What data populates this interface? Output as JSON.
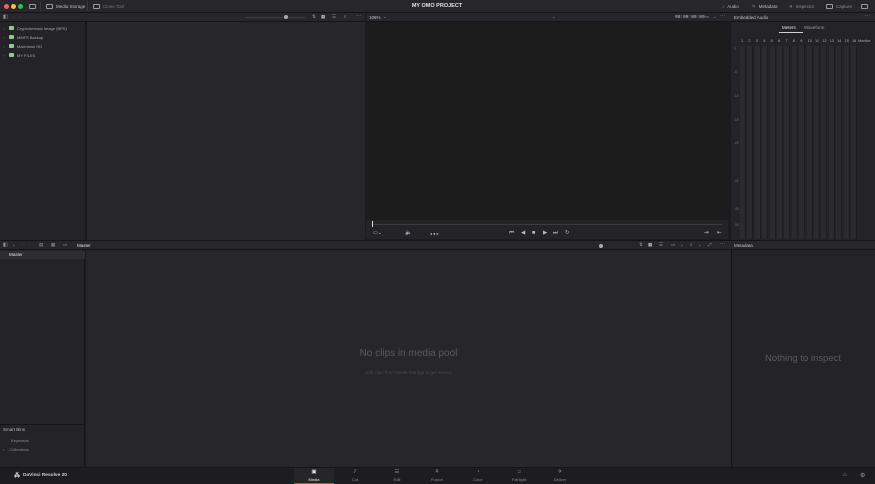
{
  "titlebar": {
    "project_title": "MY OMO PROJECT",
    "left_buttons": [
      {
        "label": "Media Storage"
      },
      {
        "label": "Clone Tool"
      }
    ],
    "right_buttons": [
      {
        "label": "Audio",
        "icon": "music-note-icon"
      },
      {
        "label": "Metadata",
        "icon": "metadata-icon"
      },
      {
        "label": "Inspector",
        "icon": "inspector-icon"
      },
      {
        "label": "Capture",
        "icon": "capture-icon"
      }
    ]
  },
  "media_storage": {
    "items": [
      {
        "label": "Cryptoforensic Image (BPS)"
      },
      {
        "label": "MMFS Backup"
      },
      {
        "label": "Macintosh HD"
      },
      {
        "label": "MY FILES"
      }
    ]
  },
  "viewer": {
    "zoom": "106%",
    "timecode": "00:00:00:00"
  },
  "audio": {
    "title": "Embedded Audio",
    "tabs": [
      "Meters",
      "Waveform"
    ],
    "active_tab": "Meters",
    "channels": [
      "1",
      "2",
      "3",
      "4",
      "5",
      "6",
      "7",
      "8",
      "9",
      "10",
      "11",
      "12",
      "13",
      "14",
      "15",
      "16"
    ],
    "channel_label": "Monitor",
    "db_marks": [
      "0",
      "-5",
      "-10",
      "-15",
      "-20",
      "-30",
      "-40",
      "-50"
    ]
  },
  "media_pool": {
    "breadcrumb": "Master",
    "bin_master": "Master",
    "empty_title": "No clips in media pool",
    "empty_subtitle": "Add clips from Media Storage to get started",
    "smart_bins": {
      "title": "Smart Bins",
      "items": [
        "Keywords",
        "Collections"
      ]
    }
  },
  "metadata": {
    "title": "Metadata",
    "empty_text": "Nothing to inspect"
  },
  "pagebar": {
    "brand": "DaVinci Resolve 20",
    "pages": [
      {
        "label": "Media",
        "icon": "media-page-icon",
        "glyph": "▣"
      },
      {
        "label": "Cut",
        "icon": "cut-page-icon",
        "glyph": "⫽"
      },
      {
        "label": "Edit",
        "icon": "edit-page-icon",
        "glyph": "☰"
      },
      {
        "label": "Fusion",
        "icon": "fusion-page-icon",
        "glyph": "⚘"
      },
      {
        "label": "Color",
        "icon": "color-page-icon",
        "glyph": "◔"
      },
      {
        "label": "Fairlight",
        "icon": "fairlight-page-icon",
        "glyph": "♫"
      },
      {
        "label": "Deliver",
        "icon": "deliver-page-icon",
        "glyph": "✈"
      }
    ],
    "active_page": "Media"
  },
  "colors": {
    "accent_red": "#d83b3b",
    "drive_green": "#8ad08a",
    "background": "#1b1b1f"
  }
}
